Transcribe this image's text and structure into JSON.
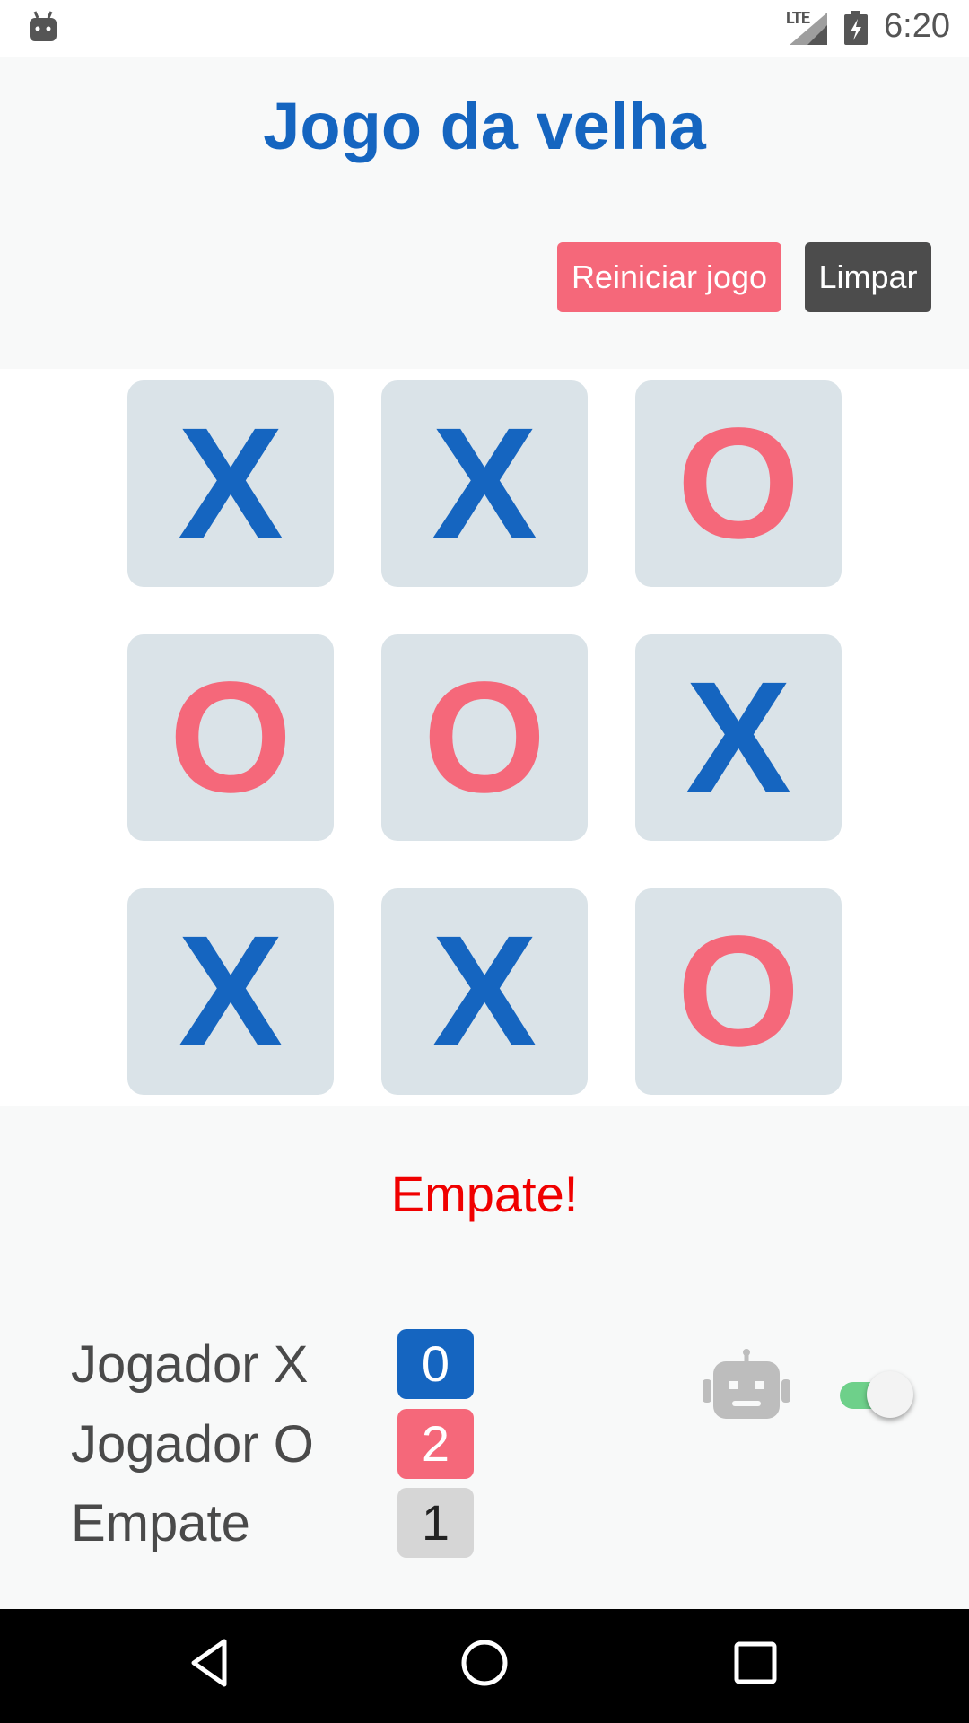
{
  "status_bar": {
    "time": "6:20",
    "network": "LTE",
    "icons": [
      "android-icon",
      "signal-icon",
      "battery-charging-icon"
    ]
  },
  "app": {
    "title": "Jogo da velha",
    "restart_label": "Reiniciar jogo",
    "clear_label": "Limpar"
  },
  "board": {
    "cells": [
      "X",
      "X",
      "O",
      "O",
      "O",
      "X",
      "X",
      "X",
      "O"
    ]
  },
  "result": "Empate!",
  "scores": {
    "player_x_label": "Jogador X",
    "player_x_value": "0",
    "player_o_label": "Jogador O",
    "player_o_value": "2",
    "draw_label": "Empate",
    "draw_value": "1"
  },
  "ai_toggle": {
    "icon": "robot-icon",
    "enabled": true
  },
  "nav_bar": {
    "icons": [
      "back-icon",
      "home-icon",
      "recents-icon"
    ]
  },
  "colors": {
    "primary_blue": "#1565c0",
    "accent_pink": "#f5687a",
    "result_red": "#f00000",
    "toggle_green": "#6ed08a"
  }
}
